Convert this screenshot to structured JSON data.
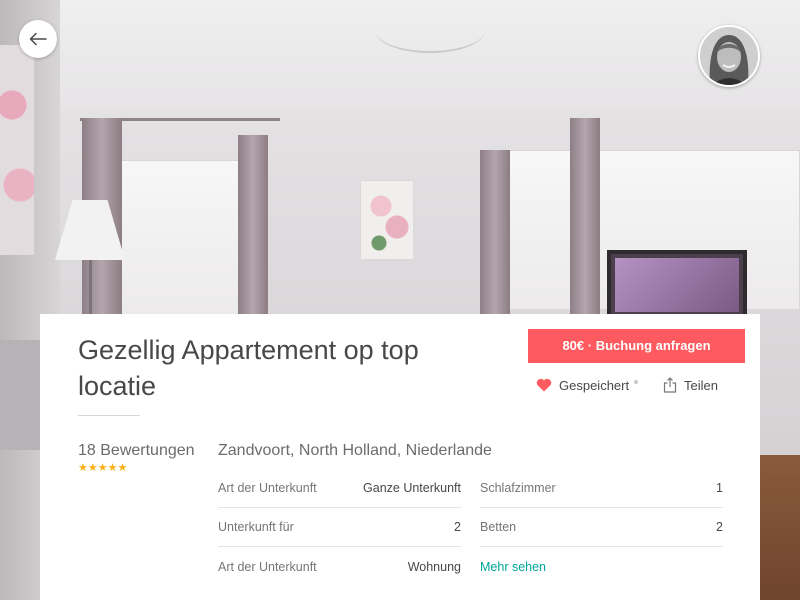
{
  "listing": {
    "title": "Gezellig Appartement op top locatie",
    "book_button": "80€ · Buchung anfragen",
    "save_label": "Gespeichert",
    "share_label": "Teilen",
    "reviews": "18 Bewertungen",
    "stars": "★★★★★",
    "rating_stars": 5,
    "location": "Zandvoort, North Holland, Niederlande"
  },
  "facts": {
    "left": [
      {
        "label": "Art der Unterkunft",
        "value": "Ganze Unterkunft"
      },
      {
        "label": "Unterkunft für",
        "value": "2"
      },
      {
        "label": "Art der Unterkunft",
        "value": "Wohnung"
      }
    ],
    "right": [
      {
        "label": "Schlafzimmer",
        "value": "1"
      },
      {
        "label": "Betten",
        "value": "2"
      }
    ],
    "more_link": "Mehr sehen"
  },
  "icons": {
    "back": "arrow-left-icon",
    "save": "heart-icon",
    "share": "share-icon",
    "host": "host-avatar"
  },
  "colors": {
    "accent": "#ff5a5f",
    "link": "#00a699",
    "stars": "#fcb017",
    "heart": "#ff5a5f"
  }
}
